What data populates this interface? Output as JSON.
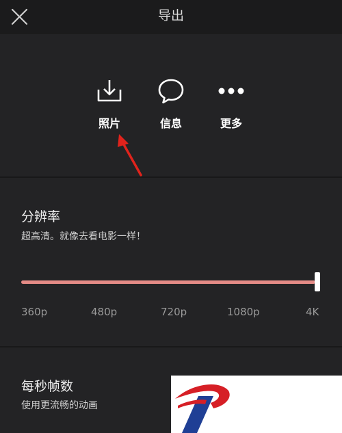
{
  "header": {
    "title": "导出"
  },
  "share": {
    "items": [
      {
        "label": "照片"
      },
      {
        "label": "信息"
      },
      {
        "label": "更多"
      }
    ]
  },
  "resolution": {
    "title": "分辨率",
    "description": "超高清。就像去看电影一样！",
    "options": [
      "360p",
      "480p",
      "720p",
      "1080p",
      "4K"
    ],
    "selected": "4K",
    "accent_color": "#e48b86"
  },
  "framerate": {
    "title": "每秒帧数",
    "description": "使用更流畅的动画"
  }
}
